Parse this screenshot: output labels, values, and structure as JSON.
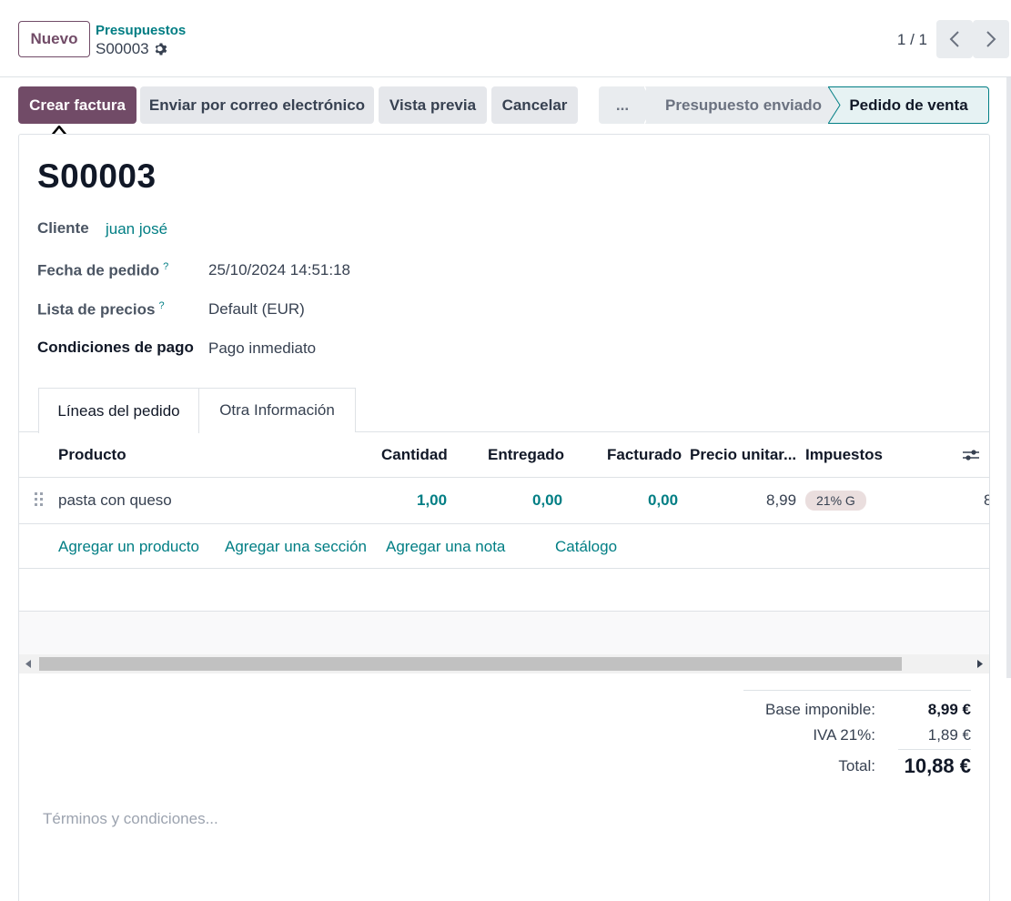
{
  "header": {
    "new_label": "Nuevo",
    "breadcrumb_parent": "Presupuestos",
    "breadcrumb_current": "S00003",
    "pager": "1 / 1"
  },
  "actions": {
    "create_invoice": "Crear factura",
    "send_email": "Enviar por correo electrónico",
    "preview": "Vista previa",
    "cancel": "Cancelar"
  },
  "statusbar": {
    "more": "...",
    "sent": "Presupuesto enviado",
    "current": "Pedido de venta"
  },
  "record": {
    "name": "S00003",
    "customer_label": "Cliente",
    "customer_value": "juan josé",
    "order_date_label": "Fecha de pedido",
    "order_date_value": "25/10/2024 14:51:18",
    "pricelist_label": "Lista de precios",
    "pricelist_value": "Default (EUR)",
    "payment_terms_label": "Condiciones de pago",
    "payment_terms_value": "Pago inmediato",
    "help_mark": "?"
  },
  "tabs": {
    "order_lines": "Líneas del pedido",
    "other_info": "Otra Información"
  },
  "table": {
    "headers": {
      "product": "Producto",
      "quantity": "Cantidad",
      "delivered": "Entregado",
      "invoiced": "Facturado",
      "unit_price": "Precio unitar...",
      "taxes": "Impuestos"
    },
    "rows": [
      {
        "product": "pasta con queso",
        "quantity": "1,00",
        "delivered": "0,00",
        "invoiced": "0,00",
        "unit_price": "8,99",
        "tax": "21% G",
        "subtotal_partial": "8"
      }
    ],
    "add_product": "Agregar un producto",
    "add_section": "Agregar una sección",
    "add_note": "Agregar una nota",
    "catalog": "Catálogo"
  },
  "totals": {
    "base_label": "Base imponible:",
    "base_value": "8,99 €",
    "iva_label": "IVA 21%:",
    "iva_value": "1,89 €",
    "total_label": "Total:",
    "total_value": "10,88 €"
  },
  "terms_placeholder": "Términos y condiciones...",
  "colors": {
    "primary": "#714B67",
    "link": "#017e84"
  }
}
